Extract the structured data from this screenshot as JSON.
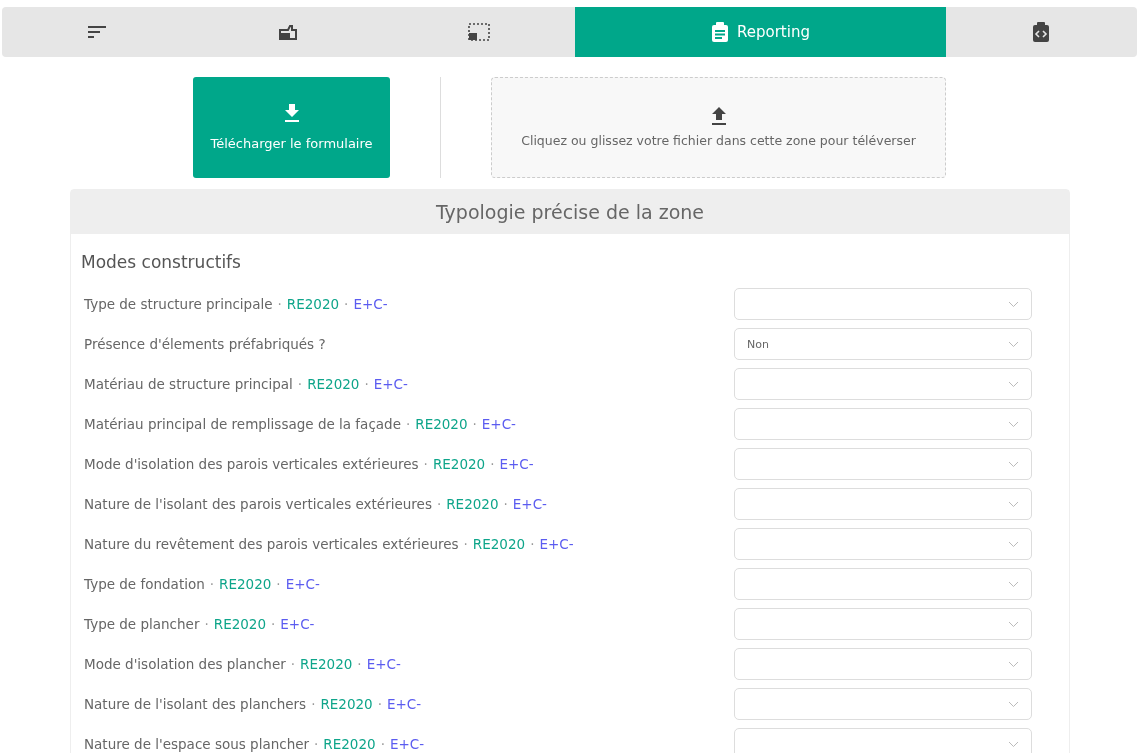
{
  "tabs": [
    {
      "selected": false
    },
    {
      "selected": false
    },
    {
      "selected": false
    },
    {
      "label": "Reporting",
      "selected": true
    },
    {
      "selected": false
    }
  ],
  "download_button": {
    "label": "Télécharger le formulaire"
  },
  "upload_zone": {
    "text": "Cliquez ou glissez votre fichier dans cette zone pour téléverser"
  },
  "panel": {
    "title": "Typologie précise de la zone",
    "section": "Modes constructifs",
    "rows": [
      {
        "label": "Type de structure principale",
        "tags": [
          {
            "sep": "·",
            "text": "RE2020",
            "color": "#0ea58a"
          },
          {
            "sep": "·",
            "text": "E+C-",
            "color": "#5b5cf0"
          }
        ]
      },
      {
        "label": "Présence d'élements préfabriqués ?",
        "value": "Non"
      },
      {
        "label": "Matériau de structure principal",
        "tags": [
          {
            "sep": "·",
            "text": "RE2020",
            "color": "#0ea58a"
          },
          {
            "sep": "·",
            "text": "E+C-",
            "color": "#5b5cf0"
          }
        ]
      },
      {
        "label": "Matériau principal de remplissage de la façade",
        "tags": [
          {
            "sep": "·",
            "text": "RE2020",
            "color": "#0ea58a"
          },
          {
            "sep": "·",
            "text": "E+C-",
            "color": "#5b5cf0"
          }
        ]
      },
      {
        "label": "Mode d'isolation des parois verticales extérieures",
        "tags": [
          {
            "sep": "·",
            "text": "RE2020",
            "color": "#0ea58a"
          },
          {
            "sep": "·",
            "text": "E+C-",
            "color": "#5b5cf0"
          }
        ]
      },
      {
        "label": "Nature de l'isolant des parois verticales extérieures",
        "tags": [
          {
            "sep": "·",
            "text": "RE2020",
            "color": "#0ea58a"
          },
          {
            "sep": "·",
            "text": "E+C-",
            "color": "#5b5cf0"
          }
        ]
      },
      {
        "label": "Nature du revêtement des parois verticales extérieures",
        "tags": [
          {
            "sep": "·",
            "text": "RE2020",
            "color": "#0ea58a"
          },
          {
            "sep": "·",
            "text": "E+C-",
            "color": "#5b5cf0"
          }
        ]
      },
      {
        "label": "Type de fondation",
        "tags": [
          {
            "sep": "·",
            "text": "RE2020",
            "color": "#0ea58a"
          },
          {
            "sep": "·",
            "text": "E+C-",
            "color": "#5b5cf0"
          }
        ]
      },
      {
        "label": "Type de plancher",
        "tags": [
          {
            "sep": "·",
            "text": "RE2020",
            "color": "#0ea58a"
          },
          {
            "sep": "·",
            "text": "E+C-",
            "color": "#5b5cf0"
          }
        ]
      },
      {
        "label": "Mode d'isolation des plancher",
        "tags": [
          {
            "sep": "·",
            "text": "RE2020",
            "color": "#0ea58a"
          },
          {
            "sep": "·",
            "text": "E+C-",
            "color": "#5b5cf0"
          }
        ]
      },
      {
        "label": "Nature de l'isolant des planchers",
        "tags": [
          {
            "sep": "·",
            "text": "RE2020",
            "color": "#0ea58a"
          },
          {
            "sep": "·",
            "text": "E+C-",
            "color": "#5b5cf0"
          }
        ]
      },
      {
        "label": "Nature de l'espace sous plancher",
        "tags": [
          {
            "sep": "·",
            "text": "RE2020",
            "color": "#0ea58a"
          },
          {
            "sep": "·",
            "text": "E+C-",
            "color": "#5b5cf0"
          }
        ]
      }
    ]
  }
}
